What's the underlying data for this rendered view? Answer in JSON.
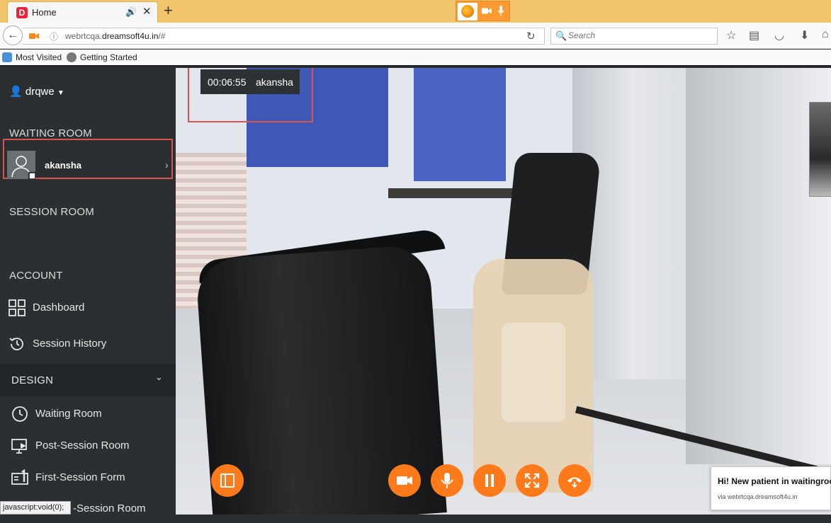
{
  "browser": {
    "tab_title": "Home",
    "favicon_letter": "D",
    "url_host": "webrtcqa.dreamsoft4u.in",
    "url_path": "/#",
    "url_prefix": "webrtcqa.",
    "url_bold": "dreamsoft4u.in",
    "search_placeholder": "Search",
    "bookmarks": [
      "Most Visited",
      "Getting Started"
    ],
    "status_text": "javascript:void(0);"
  },
  "sidebar": {
    "user_name": "drqwe",
    "waiting_room_title": "WAITING ROOM",
    "patient_name": "akansha",
    "session_room_title": "SESSION ROOM",
    "account_title": "ACCOUNT",
    "account_items": [
      "Dashboard",
      "Session History"
    ],
    "design_title": "DESIGN",
    "design_items": [
      "Waiting Room",
      "Post-Session Room",
      "First-Session Form",
      "-Session Room"
    ]
  },
  "call": {
    "duration": "00:06:55",
    "participant": "akansha"
  },
  "notification": {
    "title": "Hi! New patient in waitingroom",
    "via": "via webrtcqa.dreamsoft4u.in"
  },
  "colors": {
    "accent": "#ff7a1a",
    "sidebar_bg": "#2b2f31",
    "highlight": "#d9534f",
    "tab_strip": "#f2c46b"
  }
}
